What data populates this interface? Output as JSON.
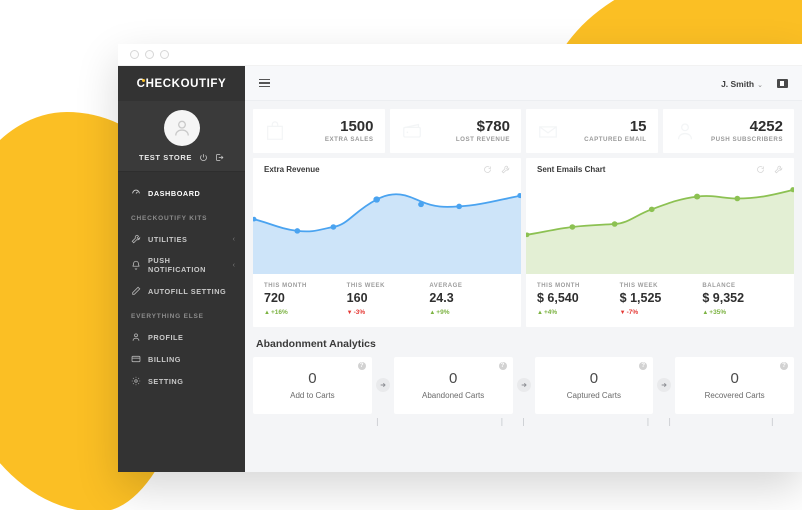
{
  "browser": {
    "dots": [
      "close",
      "minimize",
      "maximize"
    ]
  },
  "sidebar": {
    "brand": {
      "c": "C",
      "rest": "HECKOUTIFY"
    },
    "store_name": "TEST STORE",
    "avatar_icon": "user-avatar-icon",
    "store_actions": [
      {
        "name": "power-icon"
      },
      {
        "name": "logout-icon"
      }
    ],
    "primary": [
      {
        "label": "DASHBOARD",
        "icon": "dashboard-icon",
        "active": true,
        "chevron": ""
      }
    ],
    "sections": [
      {
        "title": "CHECKOUTIFY KITS",
        "items": [
          {
            "label": "UTILITIES",
            "icon": "wrench-icon",
            "chevron": "‹"
          },
          {
            "label": "PUSH NOTIFICATION",
            "icon": "bell-icon",
            "chevron": "‹"
          },
          {
            "label": "AUTOFILL SETTING",
            "icon": "pencil-icon",
            "chevron": ""
          }
        ]
      },
      {
        "title": "EVERYTHING ELSE",
        "items": [
          {
            "label": "PROFILE",
            "icon": "person-icon",
            "chevron": ""
          },
          {
            "label": "BILLING",
            "icon": "card-icon",
            "chevron": ""
          },
          {
            "label": "SETTING",
            "icon": "gear-icon",
            "chevron": ""
          }
        ]
      }
    ]
  },
  "topbar": {
    "menu_icon": "hamburger-icon",
    "user_name": "J. Smith",
    "caret": "⌄",
    "app_icon": "apps-icon"
  },
  "kpis": [
    {
      "value": "1500",
      "label": "EXTRA SALES",
      "icon": "shopping-bag-icon"
    },
    {
      "value": "$780",
      "label": "LOST REVENUE",
      "icon": "wallet-icon"
    },
    {
      "value": "15",
      "label": "CAPTURED EMAIL",
      "icon": "envelope-icon"
    },
    {
      "value": "4252",
      "label": "PUSH SUBSCRIBERS",
      "icon": "user-icon"
    }
  ],
  "charts": [
    {
      "title": "Extra Revenue",
      "accent": "#4aa3f0",
      "fill": "#cde4f9",
      "actions": [
        {
          "name": "refresh-icon"
        },
        {
          "name": "settings-wrench-icon"
        }
      ],
      "stats": [
        {
          "label": "THIS MONTH",
          "value": "720",
          "delta": "+16%",
          "dir": "up"
        },
        {
          "label": "THIS WEEK",
          "value": "160",
          "delta": "-3%",
          "dir": "down"
        },
        {
          "label": "AVERAGE",
          "value": "24.3",
          "delta": "+9%",
          "dir": "up"
        }
      ]
    },
    {
      "title": "Sent Emails Chart",
      "accent": "#8cc152",
      "fill": "#e3efd4",
      "actions": [
        {
          "name": "refresh-icon"
        },
        {
          "name": "settings-wrench-icon"
        }
      ],
      "stats": [
        {
          "label": "THIS MONTH",
          "value": "$ 6,540",
          "delta": "+4%",
          "dir": "up"
        },
        {
          "label": "THIS WEEK",
          "value": "$ 1,525",
          "delta": "-7%",
          "dir": "down"
        },
        {
          "label": "BALANCE",
          "value": "$ 9,352",
          "delta": "+35%",
          "dir": "up"
        }
      ]
    }
  ],
  "abandonment": {
    "title": "Abandonment Analytics",
    "help_glyph": "?",
    "cards": [
      {
        "value": "0",
        "label": "Add to Carts"
      },
      {
        "value": "0",
        "label": "Abandoned Carts"
      },
      {
        "value": "0",
        "label": "Captured Carts"
      },
      {
        "value": "0",
        "label": "Recovered Carts"
      }
    ]
  },
  "chart_data": [
    {
      "type": "area",
      "title": "Extra Revenue",
      "x": [
        0,
        1,
        2,
        3,
        4,
        5,
        6
      ],
      "values": [
        62,
        52,
        56,
        88,
        81,
        78,
        86
      ],
      "ylim": [
        0,
        100
      ],
      "xlabel": "",
      "ylabel": "",
      "grid": false,
      "legend": "none",
      "series_color": "#4aa3f0",
      "fill_color": "#cde4f9"
    },
    {
      "type": "area",
      "title": "Sent Emails Chart",
      "x": [
        0,
        1,
        2,
        3,
        4,
        5,
        6
      ],
      "values": [
        42,
        52,
        54,
        70,
        80,
        78,
        88
      ],
      "ylim": [
        0,
        100
      ],
      "xlabel": "",
      "ylabel": "",
      "grid": false,
      "legend": "none",
      "series_color": "#8cc152",
      "fill_color": "#e3efd4"
    }
  ]
}
